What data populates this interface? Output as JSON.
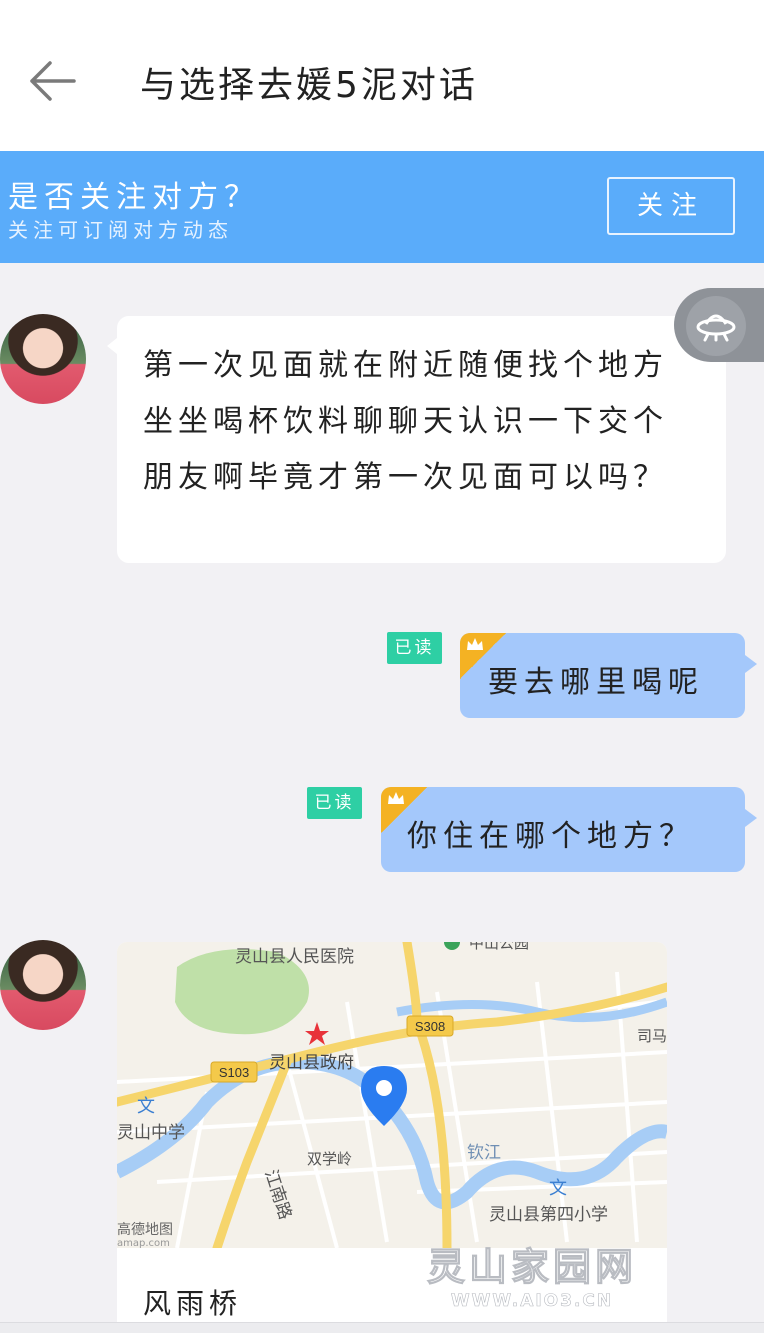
{
  "header": {
    "title": "与选择去媛5泥对话"
  },
  "follow_bar": {
    "question": "是否关注对方？",
    "subtitle": "关注可订阅对方动态",
    "button_label": "关注"
  },
  "messages": [
    {
      "side": "left",
      "type": "text",
      "text": "第一次见面就在附近随便找个地方坐坐喝杯饮料聊聊天认识一下交个朋友啊毕竟才第一次见面可以吗？"
    },
    {
      "side": "right",
      "type": "text",
      "text": "要去哪里喝呢",
      "read_label": "已读"
    },
    {
      "side": "right",
      "type": "text",
      "text": "你住在哪个地方？",
      "read_label": "已读"
    },
    {
      "side": "left",
      "type": "location",
      "place_name": "风雨桥"
    }
  ],
  "map": {
    "labels": {
      "hospital": "灵山县人民医院",
      "park": "中山公园",
      "road_s308": "S308",
      "road_s103": "S103",
      "gov": "灵山县政府",
      "school_mid": "灵山中学",
      "road_jiangnan": "江南路",
      "shuangxueling": "双学岭",
      "qinjiang": "钦江",
      "school_4": "灵山县第四小学",
      "simaa": "司马",
      "provider": "高德地图",
      "provider_url": "amap.com"
    },
    "colors": {
      "land": "#f4f1ea",
      "park_green": "#bfe0a8",
      "water": "#a7cdf6",
      "road_yellow": "#f6d56c",
      "pin": "#2a7cf0"
    }
  },
  "watermark": {
    "main": "灵山家园网",
    "sub": "WWW.AIO3.CN"
  },
  "colors": {
    "follow_bar": "#5aacfa",
    "bubble_out": "#a4c8fb",
    "read_badge": "#2ecfa4",
    "background": "#f2f1f4"
  }
}
